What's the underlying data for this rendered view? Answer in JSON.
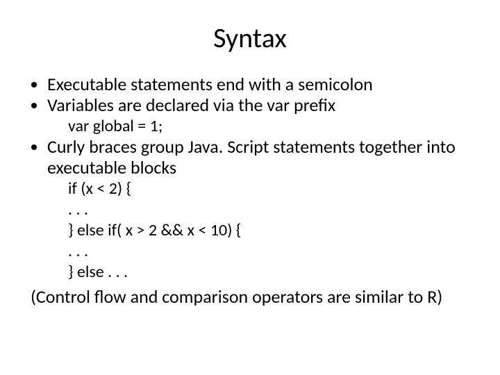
{
  "title": "Syntax",
  "bullets": {
    "b1": "Executable statements end with a semicolon",
    "b2": "Variables are declared via the var prefix",
    "b2_sub": "var global = 1;",
    "b3": "Curly braces group Java. Script statements together into executable blocks",
    "b3_code_l1": "if (x < 2) {",
    "b3_code_l2": ". . .",
    "b3_code_l3": "} else if( x > 2 && x < 10) {",
    "b3_code_l4": ". . .",
    "b3_code_l5": "} else . . ."
  },
  "footer_note": "(Control flow and comparison operators are similar to R)"
}
